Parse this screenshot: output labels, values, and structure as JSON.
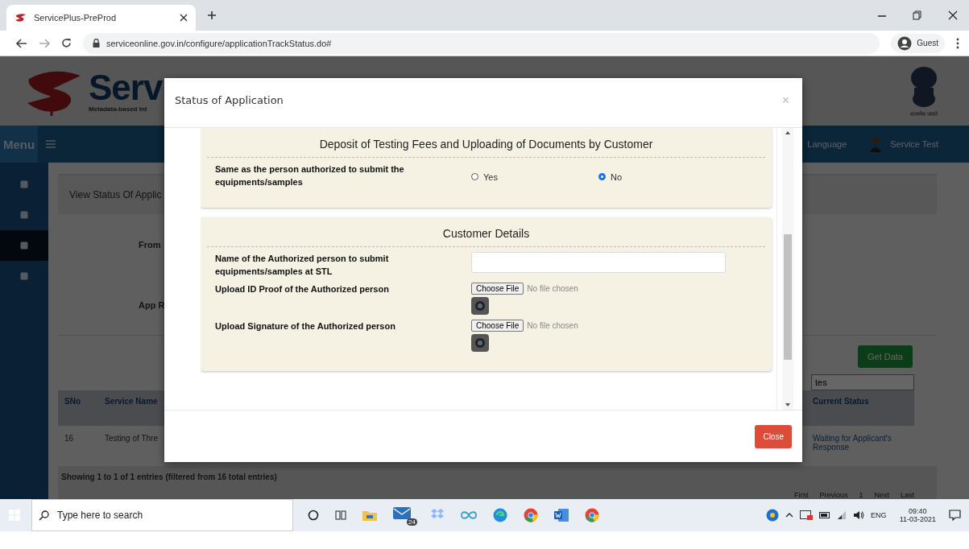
{
  "browser": {
    "tab_title": "ServicePlus-PreProd",
    "url": "serviceonline.gov.in/configure/applicationTrackStatus.do#",
    "profile": "Guest"
  },
  "site": {
    "logo_text": "Serv",
    "tagline": "Metadata-based Int",
    "emblem_caption": "सत्यमेव जयते",
    "menu_label": "Menu",
    "language": "Language",
    "user": "Service Test",
    "sidebar_items": [
      {
        "selected": false
      },
      {
        "selected": false
      },
      {
        "selected": true
      },
      {
        "selected": false
      }
    ],
    "breadcrumb": "View Status Of Applic",
    "form_labels": [
      "From",
      "App R"
    ],
    "get_data": "Get Data",
    "search_value": "tes",
    "table": {
      "columns": [
        "SNo",
        "Service Name",
        "Current Status"
      ],
      "rows": [
        {
          "sno": "16",
          "service": "Testing of Thre",
          "status": "Waiting for Applicant's Response"
        }
      ]
    },
    "footer": "Showing 1 to 1 of 1 entries (filtered from 16 total entries)",
    "pagination": [
      "First",
      "Previous",
      "1",
      "Next",
      "Last"
    ]
  },
  "modal": {
    "title": "Status of Application",
    "close_x": "×",
    "close_button": "Close",
    "sections": [
      {
        "title": "Deposit of Testing Fees and Uploading of Documents by Customer",
        "fields": [
          {
            "kind": "radio",
            "label": "Same as the person authorized to submit the equipments/samples",
            "options": [
              {
                "label": "Yes",
                "selected": false
              },
              {
                "label": "No",
                "selected": true
              }
            ]
          }
        ]
      },
      {
        "title": "Customer Details",
        "fields": [
          {
            "kind": "text",
            "label": "Name of the Authorized person to submit equipments/samples at STL"
          },
          {
            "kind": "file",
            "label": "Upload ID Proof of the Authorized person",
            "button": "Choose File",
            "status": "No file chosen"
          },
          {
            "kind": "file",
            "label": "Upload Signature of the Authorized person",
            "button": "Choose File",
            "status": "No file chosen"
          }
        ]
      }
    ]
  },
  "taskbar": {
    "search_placeholder": "Type here to search",
    "mail_badge": "24",
    "language": "ENG",
    "time": "09:40",
    "date": "11-03-2021"
  }
}
